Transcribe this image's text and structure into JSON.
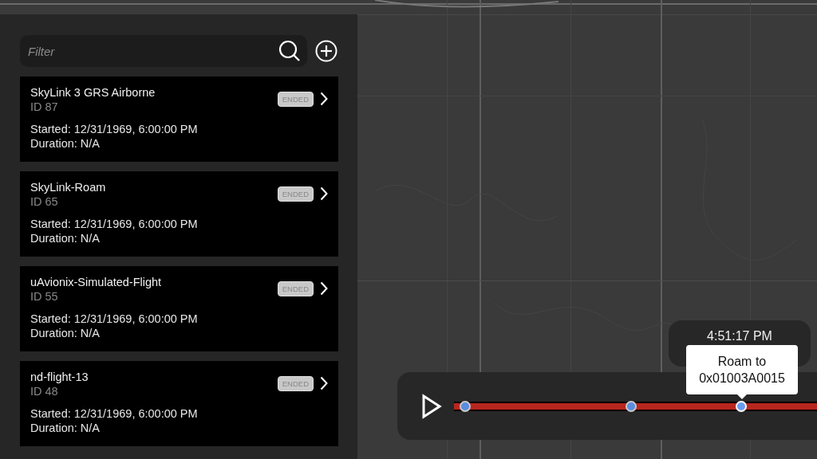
{
  "filter": {
    "placeholder": "Filter"
  },
  "flights": [
    {
      "name": "SkyLink 3 GRS Airborne",
      "id": "ID 87",
      "started": "Started: 12/31/1969, 6:00:00 PM",
      "duration": "Duration: N/A",
      "status": "ENDED"
    },
    {
      "name": "SkyLink-Roam",
      "id": "ID 65",
      "started": "Started: 12/31/1969, 6:00:00 PM",
      "duration": "Duration: N/A",
      "status": "ENDED"
    },
    {
      "name": "uAvionix-Simulated-Flight",
      "id": "ID 55",
      "started": "Started: 12/31/1969, 6:00:00 PM",
      "duration": "Duration: N/A",
      "status": "ENDED"
    },
    {
      "name": "nd-flight-13",
      "id": "ID 48",
      "started": "Started: 12/31/1969, 6:00:00 PM",
      "duration": "Duration: N/A",
      "status": "ENDED"
    }
  ],
  "playback": {
    "time": "4:51:17 PM",
    "playing": false,
    "markers": [
      {
        "selected": false
      },
      {
        "selected": false
      },
      {
        "selected": true,
        "tooltip": [
          "Roam to",
          "0x01003A0015"
        ]
      }
    ]
  }
}
